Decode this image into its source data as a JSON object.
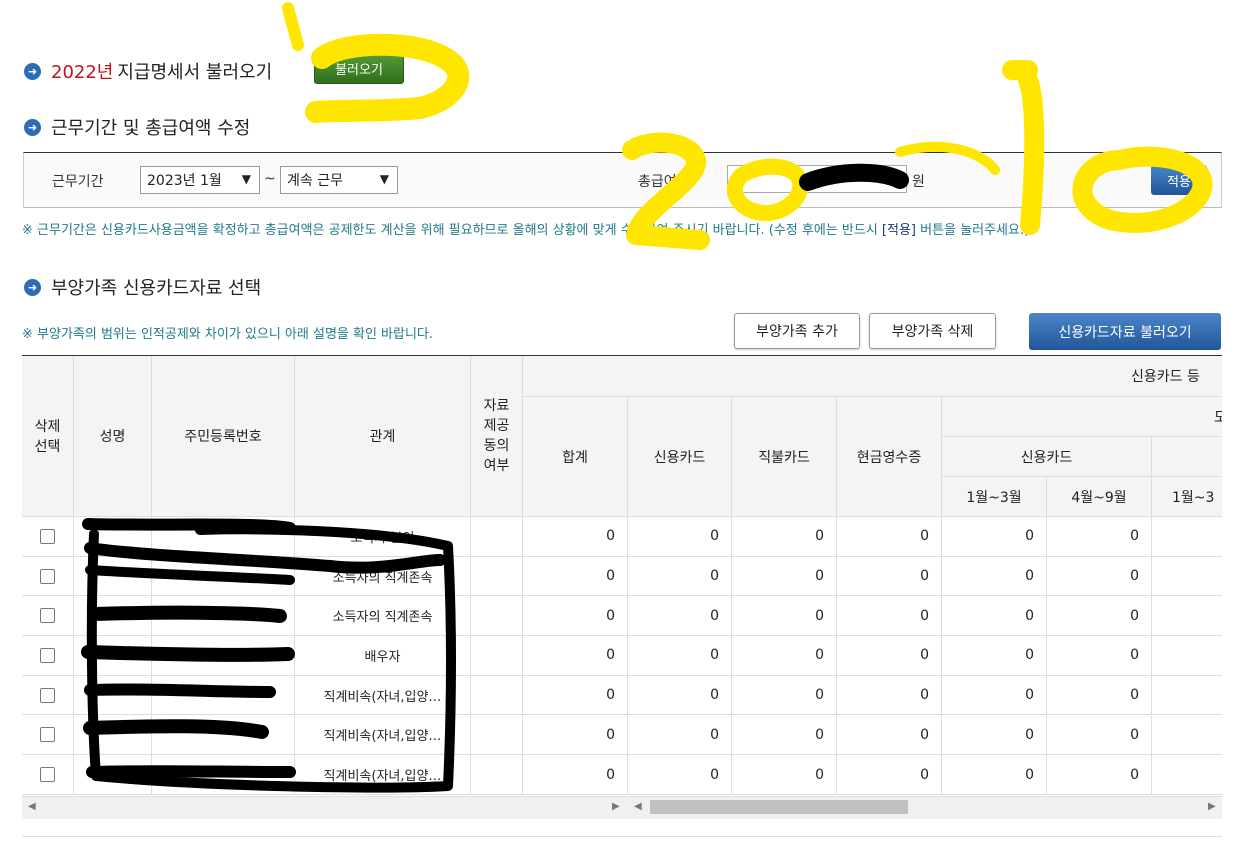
{
  "section1": {
    "year": "2022년",
    "title": "지급명세서 불러오기",
    "button": "불러오기"
  },
  "section2": {
    "title": "근무기간 및 총급여액 수정"
  },
  "form": {
    "period_label": "근무기간",
    "period_start": "2023년 1월",
    "tilde": "~",
    "period_end": "계속 근무",
    "salary_label": "총급여액",
    "salary_value": "",
    "won": "원",
    "apply_button": "적용"
  },
  "note1_a": "※ 근무기간은 신용카드사용금액을 확정하고 총급여액은 공제한도 계산을 위해 필요하므로 올해의 상황에 맞게 수정하여 주시기 바랍니다. (수정 후에는 반드시 ",
  "note1_b": "[적용]",
  "note1_c": " 버튼을 눌러주세요.)",
  "section3": {
    "title": "부양가족 신용카드자료 선택"
  },
  "note2": "※ 부양가족의 범위는 인적공제와 차이가 있으니 아래 설명을 확인 바랍니다.",
  "buttons": {
    "add": "부양가족 추가",
    "delete": "부양가족 삭제",
    "load": "신용카드자료 불러오기"
  },
  "table": {
    "headers": {
      "select": "삭제\n선택",
      "name": "성명",
      "ssn": "주민등록번호",
      "relation": "관계",
      "consent": "자료\n제공\n동의\n여부",
      "group_top": "신용카드 등",
      "total": "합계",
      "credit": "신용카드",
      "debit": "직불카드",
      "cash": "현금영수증",
      "group_mid": "도",
      "sub_credit": "신용카드",
      "m1": "1월~3월",
      "m2": "4월~9월",
      "m3": "1월~3"
    },
    "rows": [
      {
        "relation": "소득자 본인",
        "values": [
          "0",
          "0",
          "0",
          "0",
          "0",
          "0"
        ]
      },
      {
        "relation": "소득자의 직계존속",
        "values": [
          "0",
          "0",
          "0",
          "0",
          "0",
          "0"
        ]
      },
      {
        "relation": "소득자의 직계존속",
        "values": [
          "0",
          "0",
          "0",
          "0",
          "0",
          "0"
        ]
      },
      {
        "relation": "배우자",
        "values": [
          "0",
          "0",
          "0",
          "0",
          "0",
          "0"
        ]
      },
      {
        "relation": "직계비속(자녀,입양…",
        "values": [
          "0",
          "0",
          "0",
          "0",
          "0",
          "0"
        ]
      },
      {
        "relation": "직계비속(자녀,입양…",
        "values": [
          "0",
          "0",
          "0",
          "0",
          "0",
          "0"
        ]
      },
      {
        "relation": "직계비속(자녀,입양…",
        "values": [
          "0",
          "0",
          "0",
          "0",
          "0",
          "0"
        ]
      }
    ]
  },
  "colors": {
    "accent_blue": "#2a6db5",
    "year_red": "#c0121e",
    "note_teal": "#1e7a8a",
    "highlight_yellow": "#ffe600"
  }
}
